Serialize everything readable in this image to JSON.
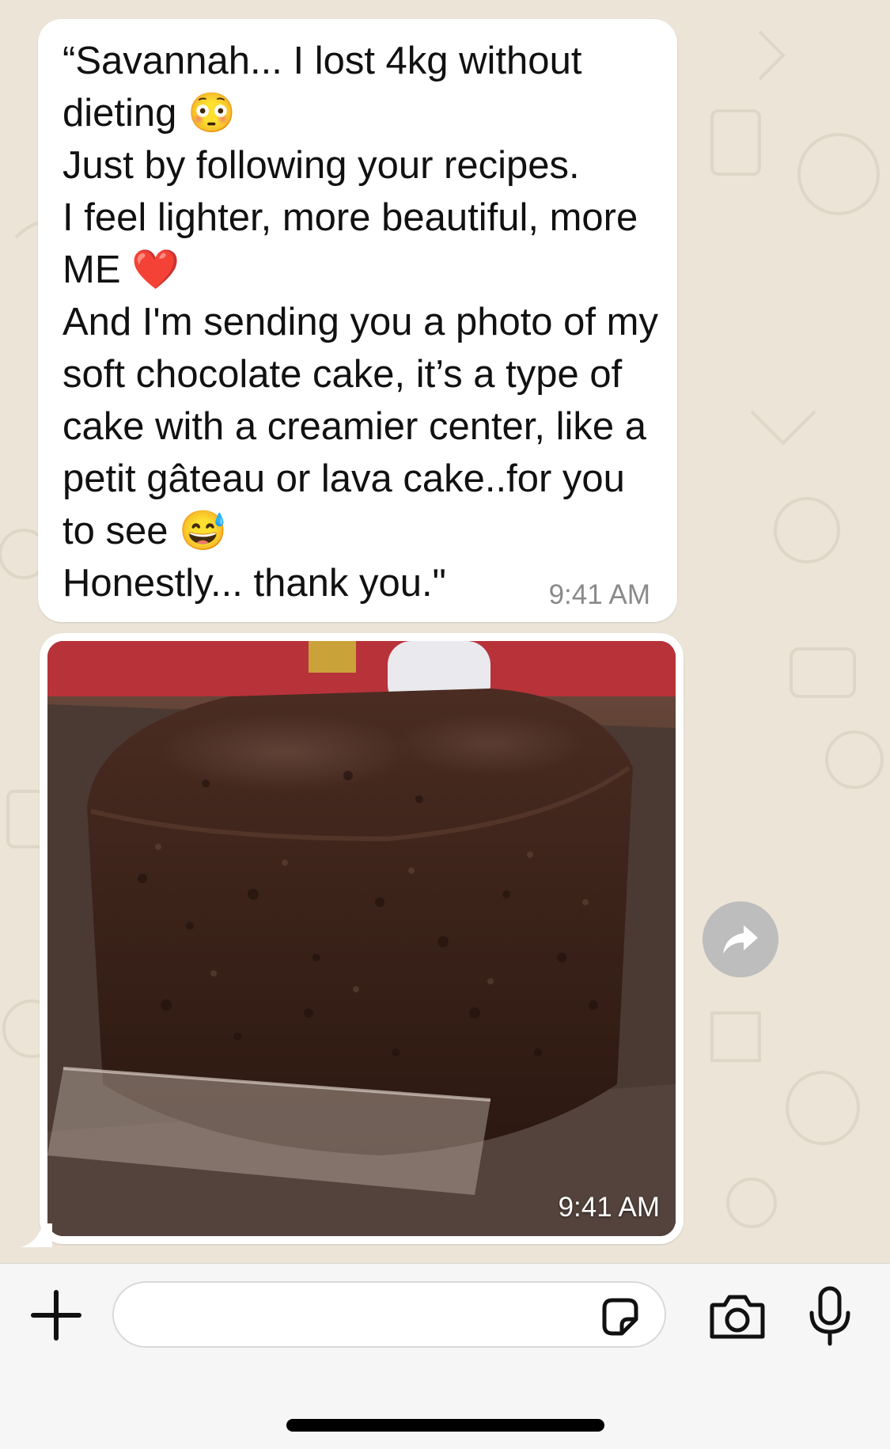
{
  "conversation": {
    "message": {
      "text": "“Savannah... I lost 4kg without dieting 😳\nJust by following your recipes.\nI feel lighter, more beautiful, more ME ❤️\nAnd I'm sending you a photo of my soft chocolate cake, it’s a type of cake with a creamier center, like a petit gâteau or lava cake..for you to see 😅\nHonestly... thank you.\"",
      "time": "9:41 AM"
    },
    "image_message": {
      "time": "9:41 AM"
    }
  },
  "icons": {
    "forward": "forward-arrow-icon",
    "attach": "plus-icon",
    "sticker": "sticker-icon",
    "camera": "camera-icon",
    "microphone": "microphone-icon"
  },
  "composer": {
    "value": ""
  },
  "colors": {
    "background": "#ece4d7",
    "bubble": "#ffffff",
    "input_bar": "#f6f6f6",
    "forward_button": "#bdbdbd"
  }
}
